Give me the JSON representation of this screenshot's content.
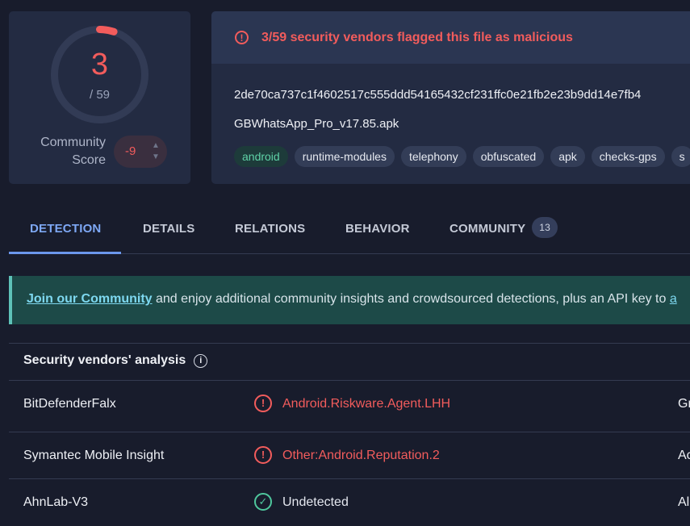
{
  "score": {
    "detections": "3",
    "total": "/ 59",
    "detection_ratio": 0.0508,
    "community_label_line1": "Community",
    "community_label_line2": "Score",
    "community_value": "-9",
    "up_arrow": "▲",
    "down_arrow": "▼"
  },
  "alert": {
    "icon": "!",
    "text": "3/59 security vendors flagged this file as malicious"
  },
  "file": {
    "hash": "2de70ca737c1f4602517c555ddd54165432cf231ffc0e21fb2e23b9dd14e7fb4",
    "name": "GBWhatsApp_Pro_v17.85.apk",
    "tags": [
      "android",
      "runtime-modules",
      "telephony",
      "obfuscated",
      "apk",
      "checks-gps",
      "s"
    ]
  },
  "tabs": [
    {
      "label": "DETECTION"
    },
    {
      "label": "DETAILS"
    },
    {
      "label": "RELATIONS"
    },
    {
      "label": "BEHAVIOR"
    },
    {
      "label": "COMMUNITY",
      "badge": "13"
    }
  ],
  "banner": {
    "link": "Join our Community",
    "text": " and enjoy additional community insights and crowdsourced detections, plus an API key to ",
    "link2": "a"
  },
  "vendors": {
    "title": "Security vendors' analysis",
    "info_icon": "i",
    "rows": [
      {
        "vendor": "BitDefenderFalx",
        "icon": "!",
        "result": "Android.Riskware.Agent.LHH",
        "col3": "Gr"
      },
      {
        "vendor": "Symantec Mobile Insight",
        "icon": "!",
        "result": "Other:Android.Reputation.2",
        "col3": "Ac"
      },
      {
        "vendor": "AhnLab-V3",
        "icon": "✓",
        "result": "Undetected",
        "col3": "Al"
      }
    ]
  },
  "colors": {
    "background": "#181c2c",
    "card": "#232b42",
    "malicious": "#f25c5c",
    "accent": "#7ea8f5",
    "clean": "#4fc79d"
  }
}
